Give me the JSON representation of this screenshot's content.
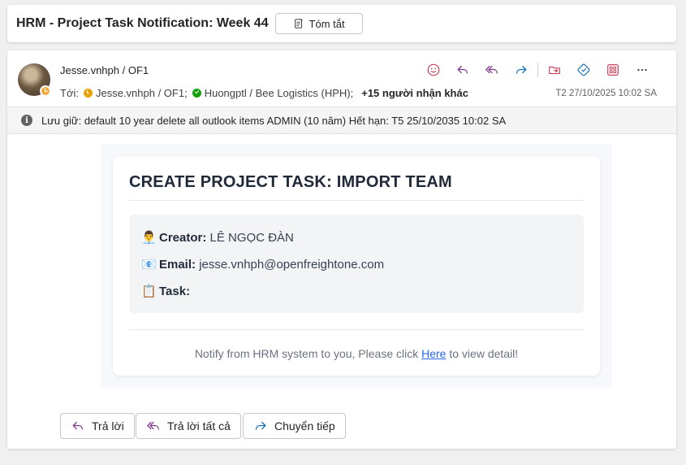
{
  "subject": {
    "title": "HRM - Project Task Notification: Week 44",
    "summary_label": "Tóm tắt"
  },
  "message": {
    "sender": "Jesse.vnhph / OF1",
    "to_prefix": "Tới:",
    "recipients": [
      {
        "name": "Jesse.vnhph / OF1;",
        "status": "away"
      },
      {
        "name": "Huongptl / Bee Logistics (HPH);",
        "status": "available"
      }
    ],
    "more_recipients": "+15 người nhận khác",
    "date": "T2 27/10/2025 10:02 SA",
    "actions": [
      "emoji-icon",
      "reply-icon",
      "reply-all-icon",
      "forward-icon",
      "move-icon",
      "teams-icon",
      "apps-icon",
      "more-icon"
    ]
  },
  "retention": {
    "text": "Lưu giữ: default 10 year delete all outlook items ADMIN (10 năm) Hết hạn: T5 25/10/2035 10:02 SA"
  },
  "body": {
    "title": "CREATE PROJECT TASK: IMPORT TEAM",
    "creator_emoji": "👨‍💼",
    "creator_key": "Creator:",
    "creator_value": "LÊ NGỌC ĐÀN",
    "email_emoji": "📧",
    "email_key": "Email:",
    "email_value": "jesse.vnhph@openfreightone.com",
    "task_emoji": "📋",
    "task_key": "Task:",
    "task_value": "",
    "footer_prefix": "Notify from HRM system to you, Please click",
    "footer_link": "Here",
    "footer_suffix": "to view detail!"
  },
  "buttons": {
    "reply": "Trả lời",
    "reply_all": "Trả lời tất cả",
    "forward": "Chuyển tiếp"
  },
  "colors": {
    "accent_purple": "#7c3a8e",
    "accent_blue": "#0f6cbd",
    "link": "#2563eb",
    "danger": "#c4314b"
  }
}
